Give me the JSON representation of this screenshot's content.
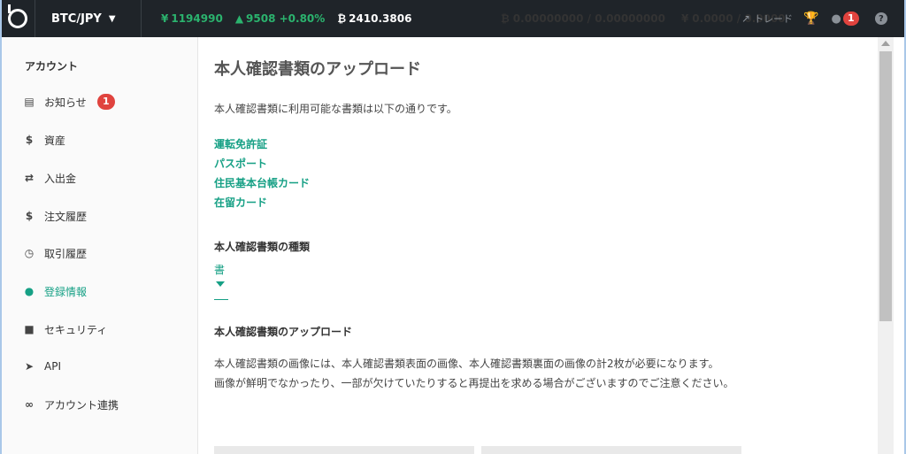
{
  "topbar": {
    "pair": "BTC/JPY",
    "price_symbol": "¥",
    "price": "1194990",
    "change": "9508 +0.80%",
    "volume_symbol": "₿",
    "volume": "2410.3806",
    "btc_symbol": "₿",
    "btc_balance": "0.00000000 / 0.00000000",
    "jpy_symbol": "¥",
    "jpy_balance": "0.0000 / 0.0000",
    "trade_label": "トレード",
    "notification_count": "1",
    "help": "?"
  },
  "sidebar": {
    "title": "アカウント",
    "items": [
      {
        "label": "お知らせ",
        "icon": "inbox-icon",
        "badge": "1"
      },
      {
        "label": "資産",
        "icon": "dollar-icon"
      },
      {
        "label": "入出金",
        "icon": "transfer-icon"
      },
      {
        "label": "注文履歴",
        "icon": "dollar-icon"
      },
      {
        "label": "取引履歴",
        "icon": "clock-icon"
      },
      {
        "label": "登録情報",
        "icon": "user-icon",
        "active": true
      },
      {
        "label": "セキュリティ",
        "icon": "lock-icon"
      },
      {
        "label": "API",
        "icon": "send-icon"
      },
      {
        "label": "アカウント連携",
        "icon": "link-icon"
      }
    ]
  },
  "main": {
    "title": "本人確認書類のアップロード",
    "intro": "本人確認書類に利用可能な書類は以下の通りです。",
    "documents": [
      "運転免許証",
      "パスポート",
      "住民基本台帳カード",
      "在留カード"
    ],
    "type_heading": "本人確認書類の種類",
    "type_value": "書",
    "upload_heading": "本人確認書類のアップロード",
    "upload_desc_1": "本人確認書類の画像には、本人確認書類表面の画像、本人確認書類裏面の画像の計2枚が必要になります。",
    "upload_desc_2": "画像が鮮明でなかったり、一部が欠けていたりすると再提出を求める場合がございますのでご注意ください。"
  },
  "colors": {
    "accent": "#16a085",
    "topbar_bg": "#1f2429",
    "price_green": "#2bb36e",
    "badge_red": "#e0433e",
    "trophy": "#e7a300"
  }
}
